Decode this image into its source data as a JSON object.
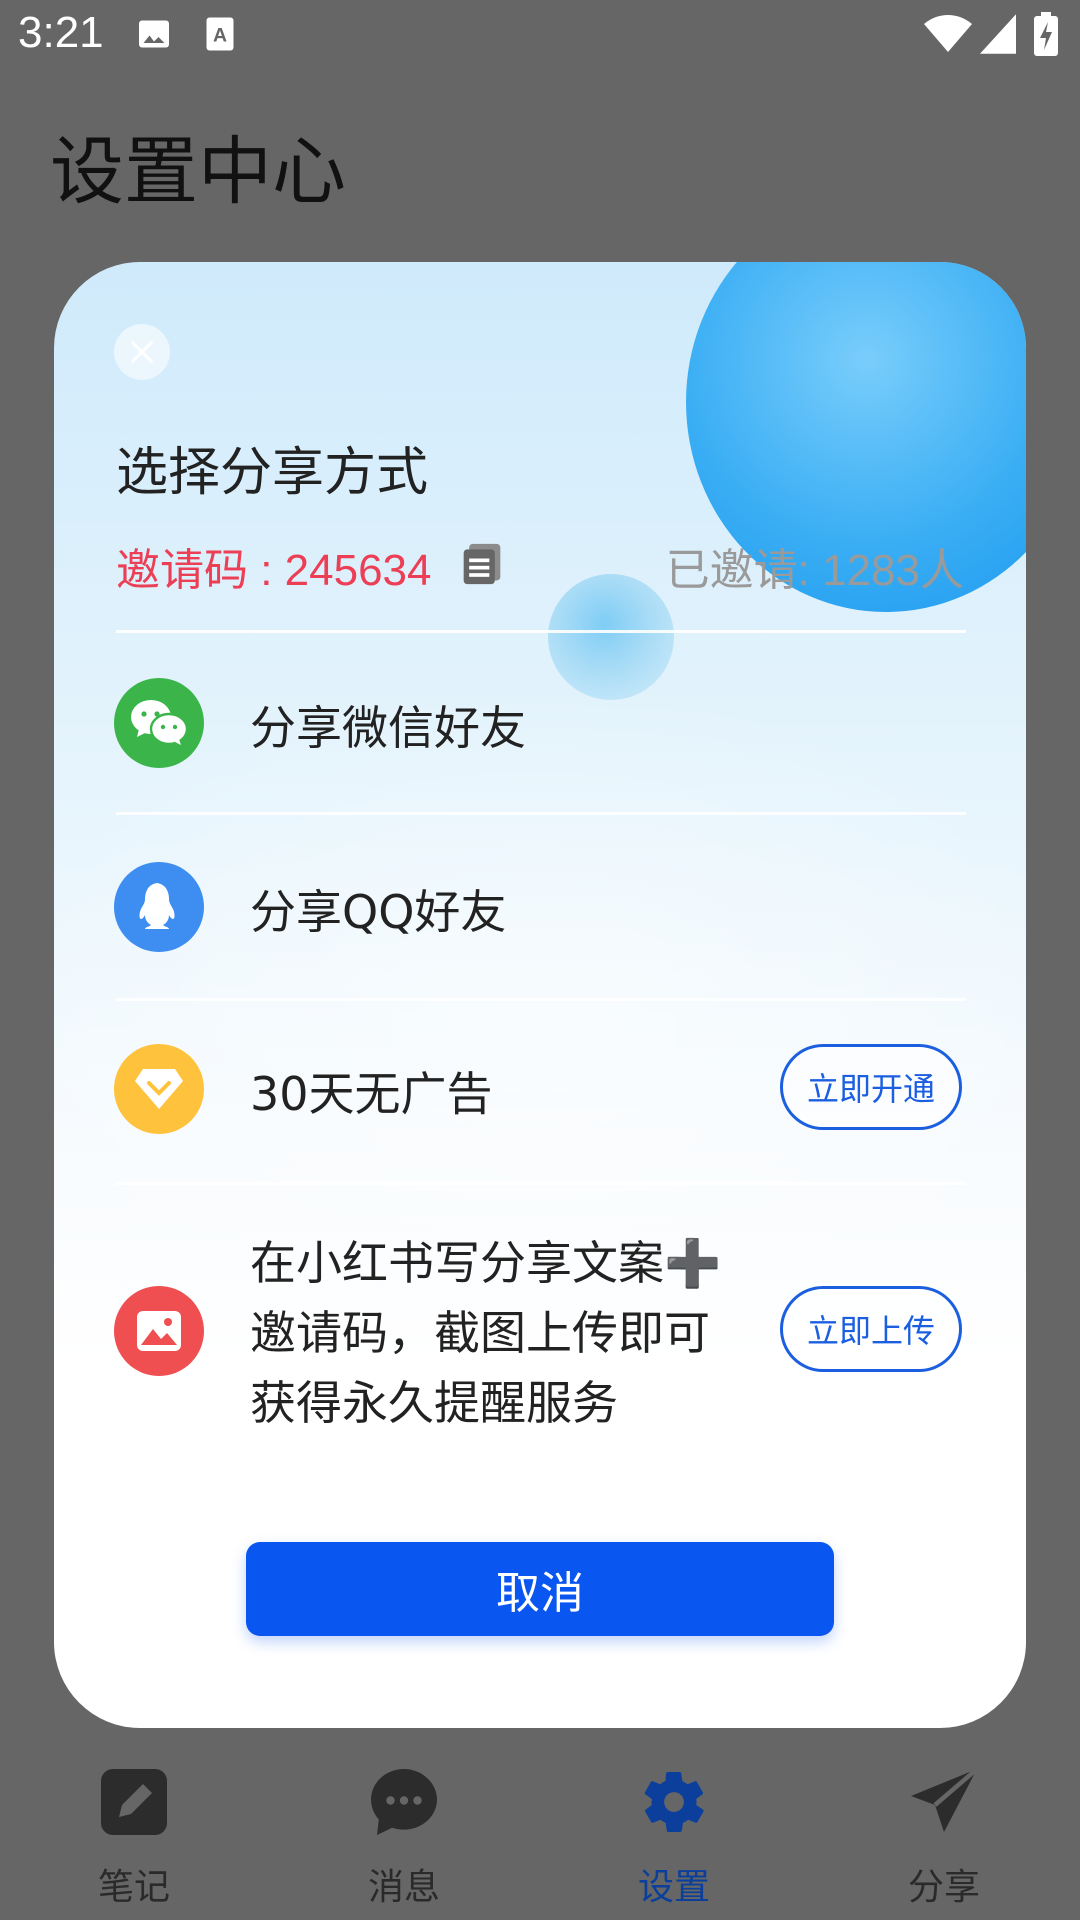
{
  "status_bar": {
    "time": "3:21",
    "icons": [
      "image-icon",
      "text-a-icon",
      "wifi-icon",
      "signal-icon",
      "battery-charging-icon"
    ]
  },
  "page": {
    "title": "设置中心"
  },
  "dialog": {
    "title": "选择分享方式",
    "invite_code_text": "邀请码 : 245634",
    "invited_count_text": "已邀请: 1283人",
    "options": [
      {
        "label": "分享微信好友",
        "icon": "wechat-icon",
        "icon_color": "#3bb54a"
      },
      {
        "label": "分享QQ好友",
        "icon": "qq-icon",
        "icon_color": "#3d8ef0"
      },
      {
        "label": "30天无广告",
        "icon": "diamond-icon",
        "icon_color": "#ffc23d",
        "action": "立即开通"
      },
      {
        "label_lines": [
          "在小红书写分享文案➕",
          "邀请码，截图上传即可",
          "获得永久提醒服务"
        ],
        "icon": "image-icon",
        "icon_color": "#ef4f51",
        "action": "立即上传"
      }
    ],
    "cancel_label": "取消"
  },
  "bottom_nav": {
    "items": [
      {
        "label": "笔记",
        "icon": "edit-icon"
      },
      {
        "label": "消息",
        "icon": "chat-icon"
      },
      {
        "label": "设置",
        "icon": "gear-icon",
        "active": true
      },
      {
        "label": "分享",
        "icon": "send-icon"
      }
    ]
  },
  "colors": {
    "accent": "#0a56f0",
    "invite": "#ec3f56",
    "overlay": "#666666"
  }
}
